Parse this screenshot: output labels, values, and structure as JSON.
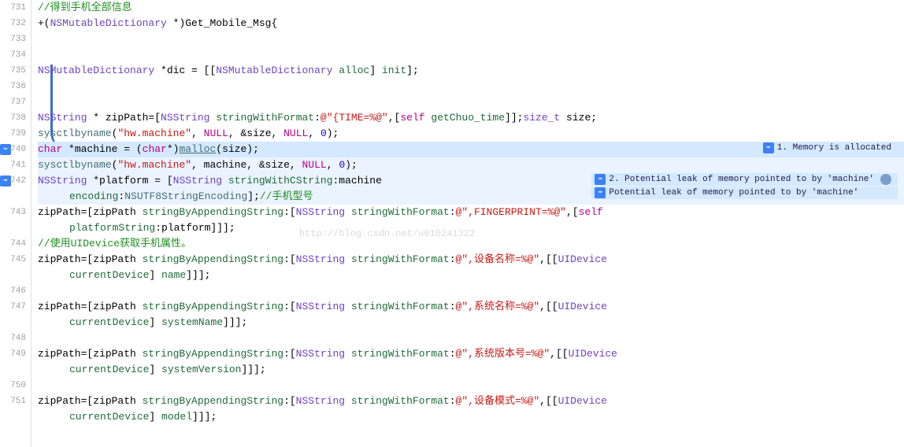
{
  "lines": {
    "731": {
      "num": "731"
    },
    "732": {
      "num": "732"
    },
    "733": {
      "num": "733"
    },
    "734": {
      "num": "734"
    },
    "735": {
      "num": "735"
    },
    "736": {
      "num": "736"
    },
    "737": {
      "num": "737"
    },
    "738": {
      "num": "738"
    },
    "739": {
      "num": "739"
    },
    "740": {
      "num": "740"
    },
    "741": {
      "num": "741"
    },
    "742": {
      "num": "742"
    },
    "743": {
      "num": "743"
    },
    "744": {
      "num": "744"
    },
    "745": {
      "num": "745"
    },
    "746": {
      "num": "746"
    },
    "747": {
      "num": "747"
    },
    "748": {
      "num": "748"
    },
    "749": {
      "num": "749"
    },
    "750": {
      "num": "750"
    },
    "751": {
      "num": "751"
    }
  },
  "code": {
    "l731_comment": "//得到手机全部信息",
    "l732_a": "+(",
    "l732_type": "NSMutableDictionary",
    "l732_b": " *)Get_Mobile_Msg{",
    "l735_a": "    ",
    "l735_type1": "NSMutableDictionary",
    "l735_b": " *dic = [[",
    "l735_type2": "NSMutableDictionary",
    "l735_c": " ",
    "l735_m1": "alloc",
    "l735_d": "] ",
    "l735_m2": "init",
    "l735_e": "];",
    "l738_a": "    ",
    "l738_type1": "NSString",
    "l738_b": " * zipPath=[",
    "l738_type2": "NSString",
    "l738_c": " ",
    "l738_m1": "stringWithFormat",
    "l738_d": ":",
    "l738_str1": "@\"{TIME=%@\"",
    "l738_e": ",[",
    "l738_kw": "self",
    "l738_f": " ",
    "l738_m2": "getChuo_time",
    "l738_g": "]];",
    "l738_type3": "size_t",
    "l738_h": " size;",
    "l739_a": "    ",
    "l739_fn": "sysctlbyname",
    "l739_b": "(",
    "l739_str": "\"hw.machine\"",
    "l739_c": ", ",
    "l739_n1": "NULL",
    "l739_d": ", &size, ",
    "l739_n2": "NULL",
    "l739_e": ", ",
    "l739_num": "0",
    "l739_f": ");",
    "l740_a": "    ",
    "l740_kw": "char",
    "l740_b": " *machine = (",
    "l740_kw2": "char",
    "l740_c": "*)",
    "l740_fn": "malloc",
    "l740_d": "(size);",
    "l741_a": "    ",
    "l741_fn": "sysctlbyname",
    "l741_b": "(",
    "l741_str": "\"hw.machine\"",
    "l741_c": ", machine, &size, ",
    "l741_n1": "NULL",
    "l741_d": ", ",
    "l741_num": "0",
    "l741_e": ");",
    "l742_a": "    ",
    "l742_type1": "NSString",
    "l742_b": " *platform = [",
    "l742_type2": "NSString",
    "l742_c": " ",
    "l742_m1": "stringWithCString",
    "l742_d": ":machine",
    "l742w_a": "encoding",
    "l742w_b": ":",
    "l742w_id": "NSUTF8StringEncoding",
    "l742w_c": "];",
    "l742w_comment": "//手机型号",
    "l743_a": "    zipPath=[zipPath ",
    "l743_m1": "stringByAppendingString",
    "l743_b": ":[",
    "l743_type": "NSString",
    "l743_c": " ",
    "l743_m2": "stringWithFormat",
    "l743_d": ":",
    "l743_str": "@\",FINGERPRINT=%@\"",
    "l743_e": ",[",
    "l743_kw": "self",
    "l743w_a": "platformString",
    "l743w_b": ":platform]]];",
    "l744_comment": "    //使用UIDevice获取手机属性。",
    "l745_a": "    zipPath=[zipPath ",
    "l745_m1": "stringByAppendingString",
    "l745_b": ":[",
    "l745_type1": "NSString",
    "l745_c": " ",
    "l745_m2": "stringWithFormat",
    "l745_d": ":",
    "l745_str": "@\",设备名称=%@\"",
    "l745_e": ",[[",
    "l745_type2": "UIDevice",
    "l745w_a": "currentDevice",
    "l745w_b": "] ",
    "l745w_c": "name",
    "l745w_d": "]]];",
    "l747_a": "    zipPath=[zipPath ",
    "l747_m1": "stringByAppendingString",
    "l747_b": ":[",
    "l747_type1": "NSString",
    "l747_c": " ",
    "l747_m2": "stringWithFormat",
    "l747_d": ":",
    "l747_str": "@\",系统名称=%@\"",
    "l747_e": ",[[",
    "l747_type2": "UIDevice",
    "l747w_a": "currentDevice",
    "l747w_b": "] ",
    "l747w_c": "systemName",
    "l747w_d": "]]];",
    "l749_a": "    zipPath=[zipPath ",
    "l749_m1": "stringByAppendingString",
    "l749_b": ":[",
    "l749_type1": "NSString",
    "l749_c": " ",
    "l749_m2": "stringWithFormat",
    "l749_d": ":",
    "l749_str": "@\",系统版本号=%@\"",
    "l749_e": ",[[",
    "l749_type2": "UIDevice",
    "l749w_a": "currentDevice",
    "l749w_b": "] ",
    "l749w_c": "systemVersion",
    "l749w_d": "]]];",
    "l751_a": "    zipPath=[zipPath ",
    "l751_m1": "stringByAppendingString",
    "l751_b": ":[",
    "l751_type1": "NSString",
    "l751_c": " ",
    "l751_m2": "stringWithFormat",
    "l751_d": ":",
    "l751_str": "@\",设备模式=%@\"",
    "l751_e": ",[[",
    "l751_type2": "UIDevice",
    "l751w_a": "currentDevice",
    "l751w_b": "] ",
    "l751w_c": "model",
    "l751w_d": "]]];"
  },
  "badges": {
    "b1": "1. Memory is allocated",
    "b2": "2. Potential leak of memory pointed to by 'machine'",
    "b3": "Potential leak of memory pointed to by 'machine'"
  },
  "watermark": "http://blog.csdn.net/u010241322",
  "icon_glyph": "➡"
}
